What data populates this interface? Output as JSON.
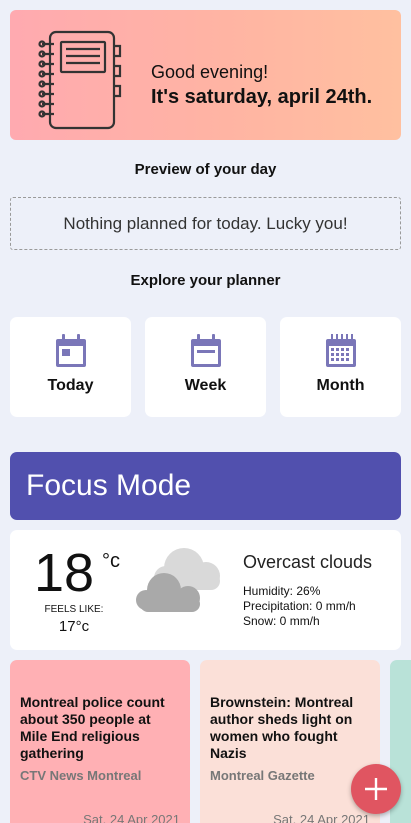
{
  "header": {
    "greeting": "Good evening!",
    "date": "It's saturday, april 24th.",
    "icon": "planner-notebook-icon"
  },
  "preview": {
    "title": "Preview of your day",
    "empty_message": "Nothing planned for today. Lucky you!"
  },
  "explore": {
    "title": "Explore your planner",
    "items": [
      {
        "label": "Today",
        "icon": "calendar-day-icon"
      },
      {
        "label": "Week",
        "icon": "calendar-week-icon"
      },
      {
        "label": "Month",
        "icon": "calendar-month-icon"
      }
    ]
  },
  "focus": {
    "label": "Focus Mode"
  },
  "weather": {
    "temperature": "18",
    "unit": "°c",
    "feels_like_label": "FEELS LIKE:",
    "feels_like": "17°c",
    "condition": "Overcast clouds",
    "icon": "cloud-icon",
    "humidity": "Humidity: 26%",
    "precipitation": "Precipitation: 0 mm/h",
    "snow": "Snow: 0 mm/h"
  },
  "news": [
    {
      "headline": "Montreal police count about 350 people at Mile End religious gathering",
      "source": "CTV News Montreal",
      "date": "Sat, 24 Apr 2021",
      "color": "#ffb0b4"
    },
    {
      "headline": "Brownstein: Montreal author sheds light on women who fought Nazis",
      "source": "Montreal Gazette",
      "date": "Sat, 24 Apr 2021",
      "color": "#fbe0d8"
    }
  ],
  "fab": {
    "icon": "plus-icon"
  },
  "colors": {
    "background": "#edf0f9",
    "accent": "#5150ae",
    "icon": "#7a76b8",
    "fab": "#e05561"
  }
}
